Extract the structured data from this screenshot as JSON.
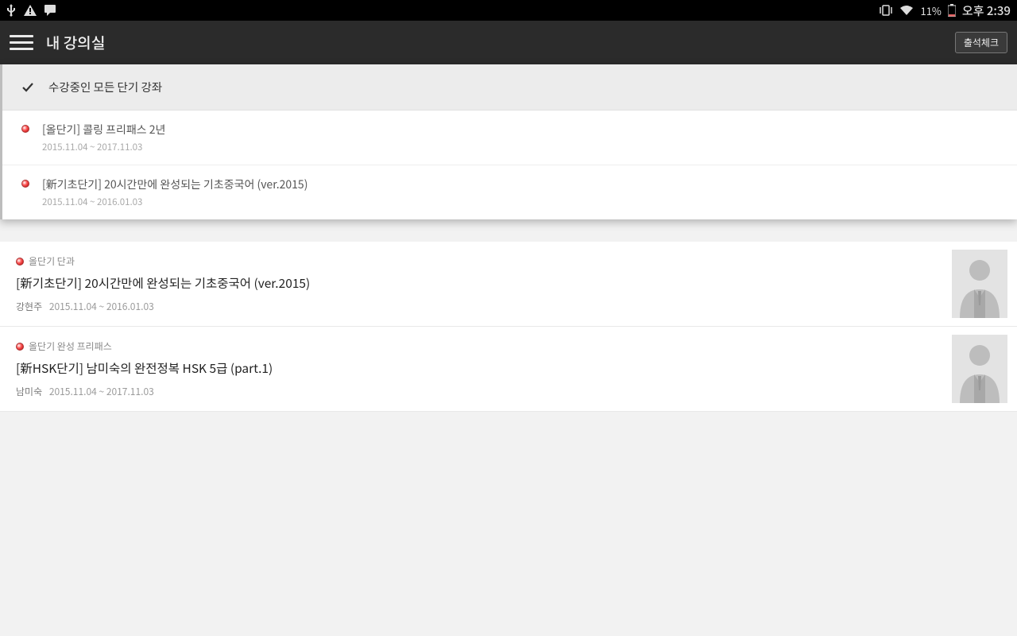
{
  "status": {
    "battery_text": "11%",
    "time": "오후 2:39"
  },
  "appbar": {
    "title": "내 강의실",
    "check_button": "출석체크"
  },
  "dropdown": {
    "header": "수강중인 모든 단기 강좌",
    "items": [
      {
        "title": "[올단기] 콜링 프리패스 2년",
        "dates": "2015.11.04 ~ 2017.11.03"
      },
      {
        "title": "[新기초단기] 20시간만에 완성되는 기초중국어 (ver.2015)",
        "dates": "2015.11.04 ~ 2016.01.03"
      }
    ]
  },
  "courses": [
    {
      "tag": "올단기 단과",
      "title": "[新기초단기] 20시간만에 완성되는 기초중국어 (ver.2015)",
      "author": "강현주",
      "dates": "2015.11.04 ~ 2016.01.03"
    },
    {
      "tag": "올단기 완성 프리패스",
      "title": "[新HSK단기] 남미숙의 완전정복 HSK 5급 (part.1)",
      "author": "남미숙",
      "dates": "2015.11.04 ~ 2017.11.03"
    }
  ]
}
